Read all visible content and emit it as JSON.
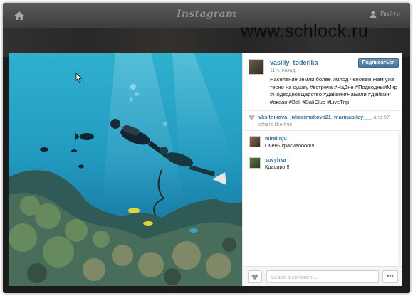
{
  "topbar": {
    "brand": "Instagram",
    "signin_label": "Войти"
  },
  "watermark": "www.schlock.ru",
  "post": {
    "username": "vasiliy_toderika",
    "follow_label": "Подписаться",
    "time": "11 ч. назад",
    "caption": "Население земли более 7млрд человек! Нам уже тесно на сушеу #встреча #НаДне #ПодводныйМир #ПодводноеЦарство #ДайвингНаБали #дайвинг #океан #Bali #BaliClub #LiveTrip",
    "likes": {
      "user1": "vksitnikova",
      "sep1": ",",
      "user2": "juliaermakova21",
      "sep2": ",",
      "user3": "marinabiley___",
      "suffix": "and 97 others like this."
    },
    "comments": [
      {
        "user": "miraiinju",
        "text": "Очень красивоооо!!!"
      },
      {
        "user": "sovyhka_",
        "text": "Красиво!!!"
      }
    ],
    "comment_placeholder": "Leave a comment...",
    "more_label": "•••"
  },
  "colors": {
    "link": "#3f729b",
    "follow_button": "#517fa4",
    "water_top": "#2fb0cf",
    "water_bottom": "#14678b"
  }
}
